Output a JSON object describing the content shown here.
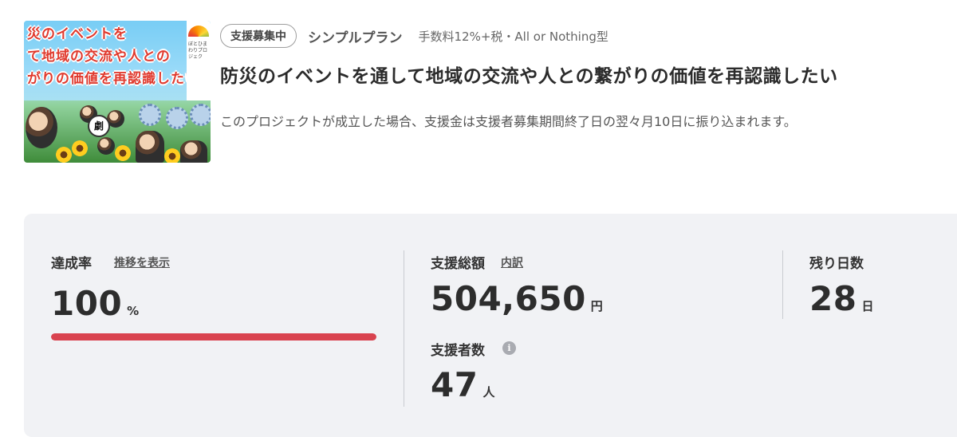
{
  "project": {
    "thumbnail": {
      "alt": "project-thumbnail",
      "banner_lines": [
        "災のイベントを",
        "て地域の交流や人との",
        "がりの価値を再認識したい"
      ],
      "side_text": "ぼとひまわりプロジェク",
      "center_mark": "劇"
    },
    "status_badge": "支援募集中",
    "plan_name": "シンプルプラン",
    "fee_text": "手数料12%+税・All or Nothing型",
    "title": "防災のイベントを通して地域の交流や人との繋がりの価値を再認識したい",
    "payout_note": "このプロジェクトが成立した場合、支援金は支援者募集期間終了日の翌々月10日に振り込まれます。"
  },
  "stats": {
    "achievement": {
      "label": "達成率",
      "link": "推移を表示",
      "value": "100",
      "unit": "%",
      "progress_fraction": 1.0,
      "bar_color": "#d9434f"
    },
    "total": {
      "label": "支援総額",
      "link": "内訳",
      "value": "504,650",
      "unit": "円"
    },
    "supporters": {
      "label": "支援者数",
      "info_icon": "info-icon",
      "value": "47",
      "unit": "人"
    },
    "remaining": {
      "label": "残り日数",
      "value": "28",
      "unit": "日"
    }
  }
}
